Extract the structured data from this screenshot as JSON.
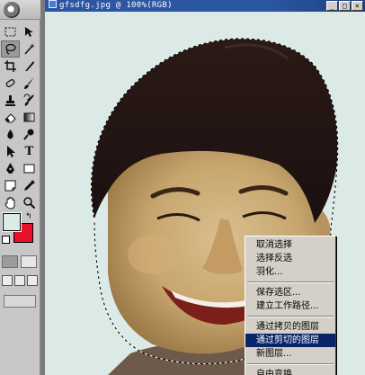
{
  "window": {
    "title": "gfsdfg.jpg @ 100%(RGB)",
    "buttons": [
      "minimize-icon",
      "maximize-icon",
      "close-icon"
    ]
  },
  "toolbox": {
    "tools": [
      "rectangular-marquee-icon",
      "move-icon",
      "lasso-icon",
      "magic-wand-icon",
      "crop-icon",
      "slice-icon",
      "healing-brush-icon",
      "brush-icon",
      "clone-stamp-icon",
      "history-brush-icon",
      "eraser-icon",
      "gradient-icon",
      "blur-icon",
      "dodge-icon",
      "path-select-icon",
      "type-icon",
      "pen-icon",
      "shape-icon",
      "notes-icon",
      "eyedropper-icon",
      "hand-icon",
      "zoom-icon"
    ],
    "active_tool": "lasso-icon",
    "foreground_color": "#d9ece6",
    "background_color": "#e8102a"
  },
  "context_menu": {
    "items": [
      {
        "label": "取消选择"
      },
      {
        "label": "选择反选"
      },
      {
        "label": "羽化..."
      },
      {
        "separator": true
      },
      {
        "label": "保存选区..."
      },
      {
        "label": "建立工作路径..."
      },
      {
        "separator": true
      },
      {
        "label": "通过拷贝的图层"
      },
      {
        "label": "通过剪切的图层",
        "highlighted": true
      },
      {
        "label": "新图层..."
      },
      {
        "separator": true
      },
      {
        "label": "自由变换"
      }
    ]
  },
  "colors": {
    "title_bar": "#2b56a0",
    "menu_highlight": "#0a246a",
    "canvas_background": "#dceae7"
  }
}
